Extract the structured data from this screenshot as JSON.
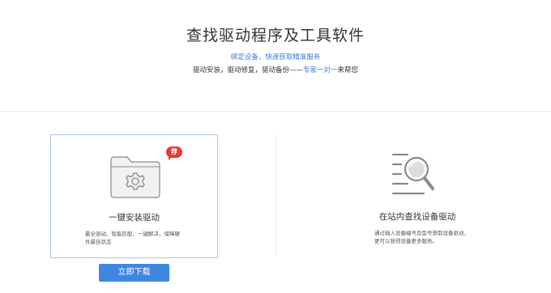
{
  "header": {
    "title": "查找驱动程序及工具软件",
    "bind_link": "绑定设备，快速获取精准服务",
    "subtitle_prefix": "驱动安装，驱动修复，驱动备份——",
    "subtitle_link": "专家一对一",
    "subtitle_suffix": "来帮您"
  },
  "install_card": {
    "badge": "荐",
    "title": "一键安装驱动",
    "description": "最全驱动、智能匹配、一键解决，保障硬件最佳状态",
    "button_label": "立即下载"
  },
  "search_card": {
    "title": "在站内查找设备驱动",
    "description": "通过输入设备编号及型号获取设备驱动，更可以获得设备更多服务。"
  },
  "colors": {
    "accent": "#3f88e0",
    "link": "#3a7fd6",
    "badge": "#e83a2e",
    "card_border": "#a9c6ea"
  }
}
